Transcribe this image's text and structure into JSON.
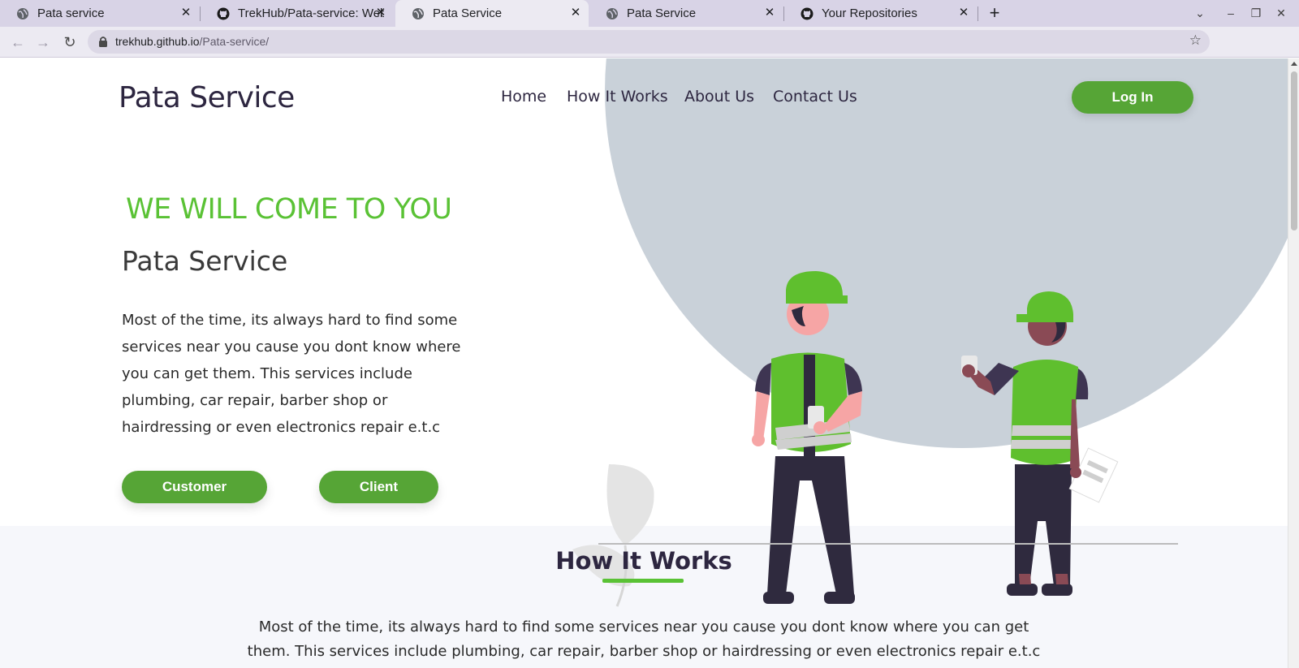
{
  "browser": {
    "tabs": [
      {
        "title": "Pata service",
        "icon": "globe-icon",
        "active": false
      },
      {
        "title": "TrekHub/Pata-service: Web",
        "icon": "github-icon",
        "active": false
      },
      {
        "title": "Pata Service",
        "icon": "globe-icon",
        "active": true
      },
      {
        "title": "Pata Service",
        "icon": "globe-icon",
        "active": false
      },
      {
        "title": "Your Repositories",
        "icon": "github-icon",
        "active": false
      }
    ],
    "url_host": "trekhub.github.io",
    "url_path": "/Pata-service/"
  },
  "header": {
    "brand": "Pata Service",
    "nav": [
      "Home",
      "How It Works",
      "About Us",
      "Contact Us"
    ],
    "login_label": "Log In"
  },
  "hero": {
    "tagline": "WE WILL COME TO YOU",
    "title": "Pata Service",
    "description": "Most of the time, its always hard to find some services near you cause you dont know where you can get them. This services include plumbing, car repair, barber shop or hairdressing or even electronics repair e.t.c",
    "customer_label": "Customer",
    "client_label": "Client"
  },
  "how_it_works": {
    "title": "How It Works",
    "description": "Most of the time, its always hard to find some services near you cause you dont know where you can get them. This services include plumbing, car repair, barber shop or hairdressing or even electronics repair e.t.c"
  },
  "colors": {
    "accent": "#5ac235",
    "button": "#56a536",
    "brand_text": "#2d2640",
    "circle": "#c9d1d9"
  }
}
